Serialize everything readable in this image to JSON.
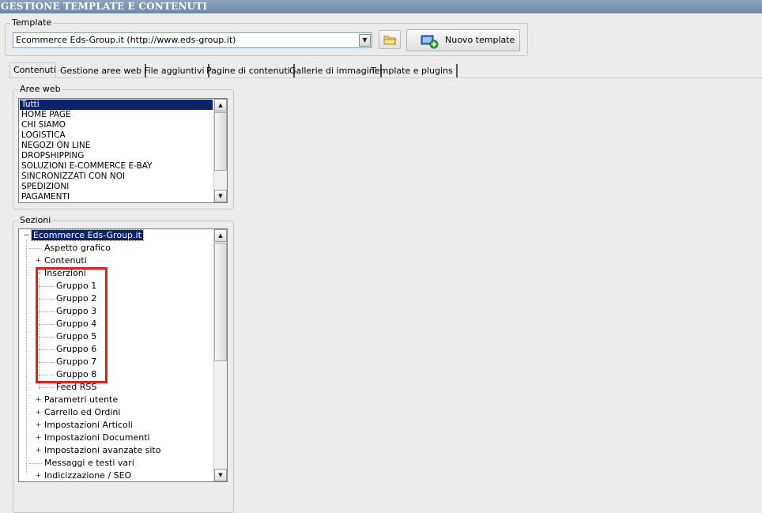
{
  "window": {
    "title": "GESTIONE TEMPLATE E CONTENUTI"
  },
  "template_group": {
    "label": "Template",
    "selected_template": "Ecommerce Eds-Group.it (http://www.eds-group.it)",
    "new_template_label": "Nuovo template"
  },
  "tabs": [
    {
      "label": "Contenuti"
    },
    {
      "label": "Gestione aree web"
    },
    {
      "label": "File aggiuntivi"
    },
    {
      "label": "Pagine di contenuti"
    },
    {
      "label": "Gallerie di immagini"
    },
    {
      "label": "Template e plugins"
    }
  ],
  "aree_web": {
    "label": "Aree web",
    "items": [
      "Tutti",
      "HOME PAGE",
      "CHI SIAMO",
      "LOGISTICA",
      "NEGOZI ON LINE",
      "DROPSHIPPING",
      "SOLUZIONI E-COMMERCE E-BAY",
      "SINCRONIZZATI CON NOI",
      "SPEDIZIONI",
      "PAGAMENTI"
    ],
    "selected_index": 0
  },
  "sezioni": {
    "label": "Sezioni",
    "root": "Ecommerce Eds-Group.it",
    "nodes": [
      {
        "label": "Aspetto grafico",
        "level": 1,
        "expander": ""
      },
      {
        "label": "Contenuti",
        "level": 1,
        "expander": "+"
      },
      {
        "label": "Inserzioni",
        "level": 1,
        "expander": "-"
      },
      {
        "label": "Gruppo 1",
        "level": 2,
        "expander": ""
      },
      {
        "label": "Gruppo 2",
        "level": 2,
        "expander": ""
      },
      {
        "label": "Gruppo 3",
        "level": 2,
        "expander": ""
      },
      {
        "label": "Gruppo 4",
        "level": 2,
        "expander": ""
      },
      {
        "label": "Gruppo 5",
        "level": 2,
        "expander": ""
      },
      {
        "label": "Gruppo 6",
        "level": 2,
        "expander": ""
      },
      {
        "label": "Gruppo 7",
        "level": 2,
        "expander": ""
      },
      {
        "label": "Gruppo 8",
        "level": 2,
        "expander": ""
      },
      {
        "label": "Feed RSS",
        "level": 2,
        "expander": ""
      },
      {
        "label": "Parametri utente",
        "level": 1,
        "expander": "+"
      },
      {
        "label": "Carrello ed Ordini",
        "level": 1,
        "expander": "+"
      },
      {
        "label": "Impostazioni Articoli",
        "level": 1,
        "expander": "+"
      },
      {
        "label": "Impostazioni Documenti",
        "level": 1,
        "expander": "+"
      },
      {
        "label": "Impostazioni avanzate sito",
        "level": 1,
        "expander": "+"
      },
      {
        "label": "Messaggi e testi vari",
        "level": 1,
        "expander": ""
      },
      {
        "label": "Indicizzazione / SEO",
        "level": 1,
        "expander": "+"
      }
    ]
  },
  "colors": {
    "titlebar": "#7b93b3",
    "selection": "#0a246a",
    "highlight_box": "#e02020"
  },
  "icons": {
    "folder_button": "folder-icon",
    "new_template": "add-template-icon"
  }
}
